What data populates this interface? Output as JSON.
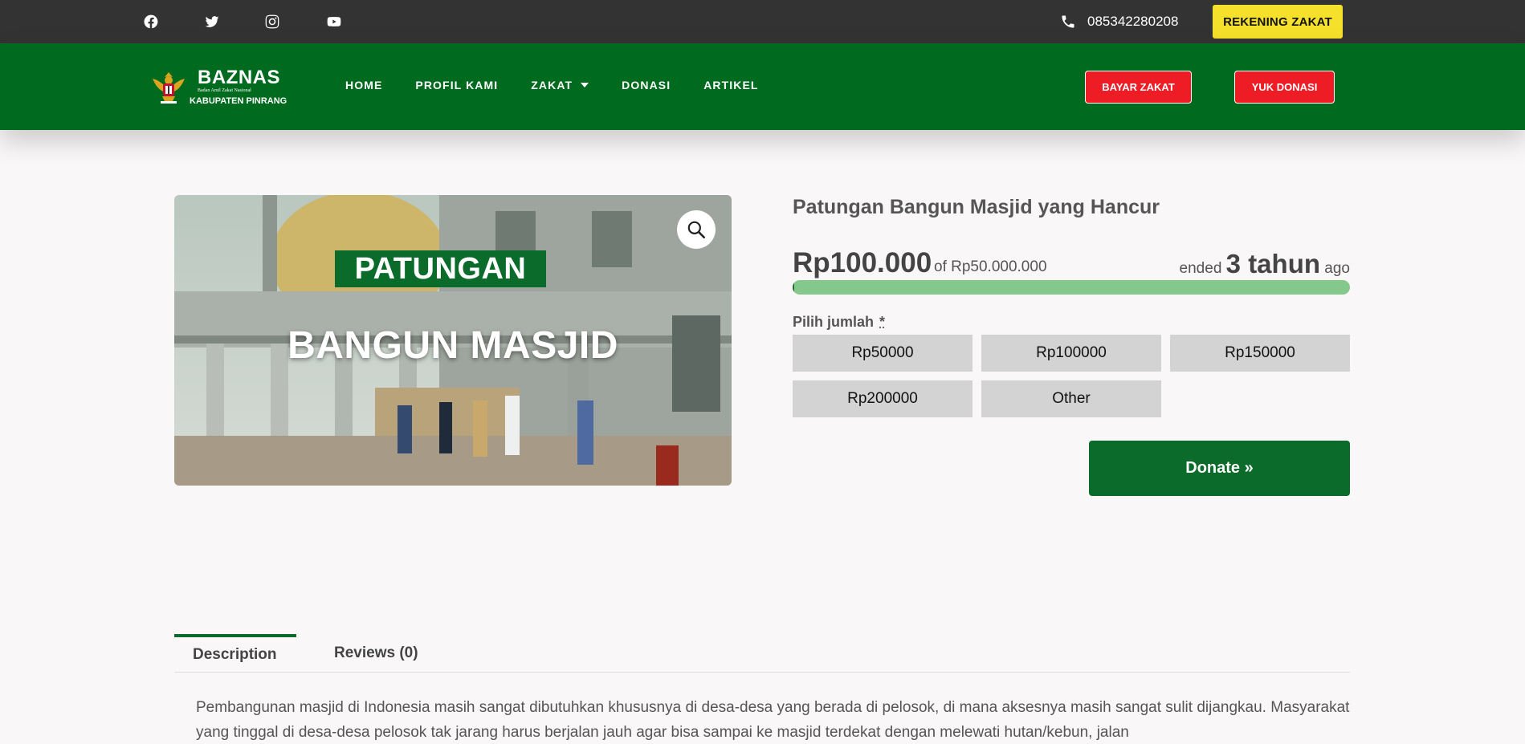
{
  "topbar": {
    "social": [
      "facebook-icon",
      "twitter-icon",
      "instagram-icon",
      "youtube-icon"
    ],
    "phone": "085342280208",
    "rekening_label": "REKENING ZAKAT"
  },
  "header": {
    "logo_title": "BAZNAS",
    "logo_sub": "Badan Amil Zakat Nasional",
    "logo_region": "KABUPATEN PINRANG",
    "nav": [
      {
        "label": "HOME"
      },
      {
        "label": "PROFIL KAMI"
      },
      {
        "label": "ZAKAT"
      },
      {
        "label": "DONASI"
      },
      {
        "label": "ARTIKEL"
      }
    ],
    "bayar_label": "BAYAR ZAKAT",
    "donasi_label": "YUK DONASI"
  },
  "product": {
    "image_line1": "PATUNGAN",
    "image_line2": "BANGUN MASJID",
    "title": "Patungan Bangun Masjid yang Hancur",
    "raised": "Rp100.000",
    "goal": "of Rp50.000.000",
    "ended_prefix": "ended",
    "ended_value": "3 tahun",
    "ended_suffix": "ago",
    "progress_fraction": 0.002,
    "choose_label": "Pilih jumlah",
    "required_mark": "*",
    "amounts": [
      "Rp50000",
      "Rp100000",
      "Rp150000",
      "Rp200000",
      "Other"
    ],
    "donate_label": "Donate »"
  },
  "tabs": [
    {
      "label": "Description",
      "active": true
    },
    {
      "label": "Reviews (0)",
      "active": false
    }
  ],
  "description": "Pembangunan masjid di Indonesia masih sangat dibutuhkan khususnya di desa-desa yang berada di pelosok, di mana aksesnya masih sangat sulit dijangkau. Masyarakat yang tinggal di desa-desa pelosok tak jarang harus berjalan jauh agar bisa sampai ke masjid terdekat dengan melewati hutan/kebun, jalan",
  "colors": {
    "topbar": "#333333",
    "header": "#006b1e",
    "accent_yellow": "#f5e12b",
    "accent_red": "#ee1c25",
    "donate_green": "#0a6b2a",
    "progress_track": "#85c88c"
  }
}
